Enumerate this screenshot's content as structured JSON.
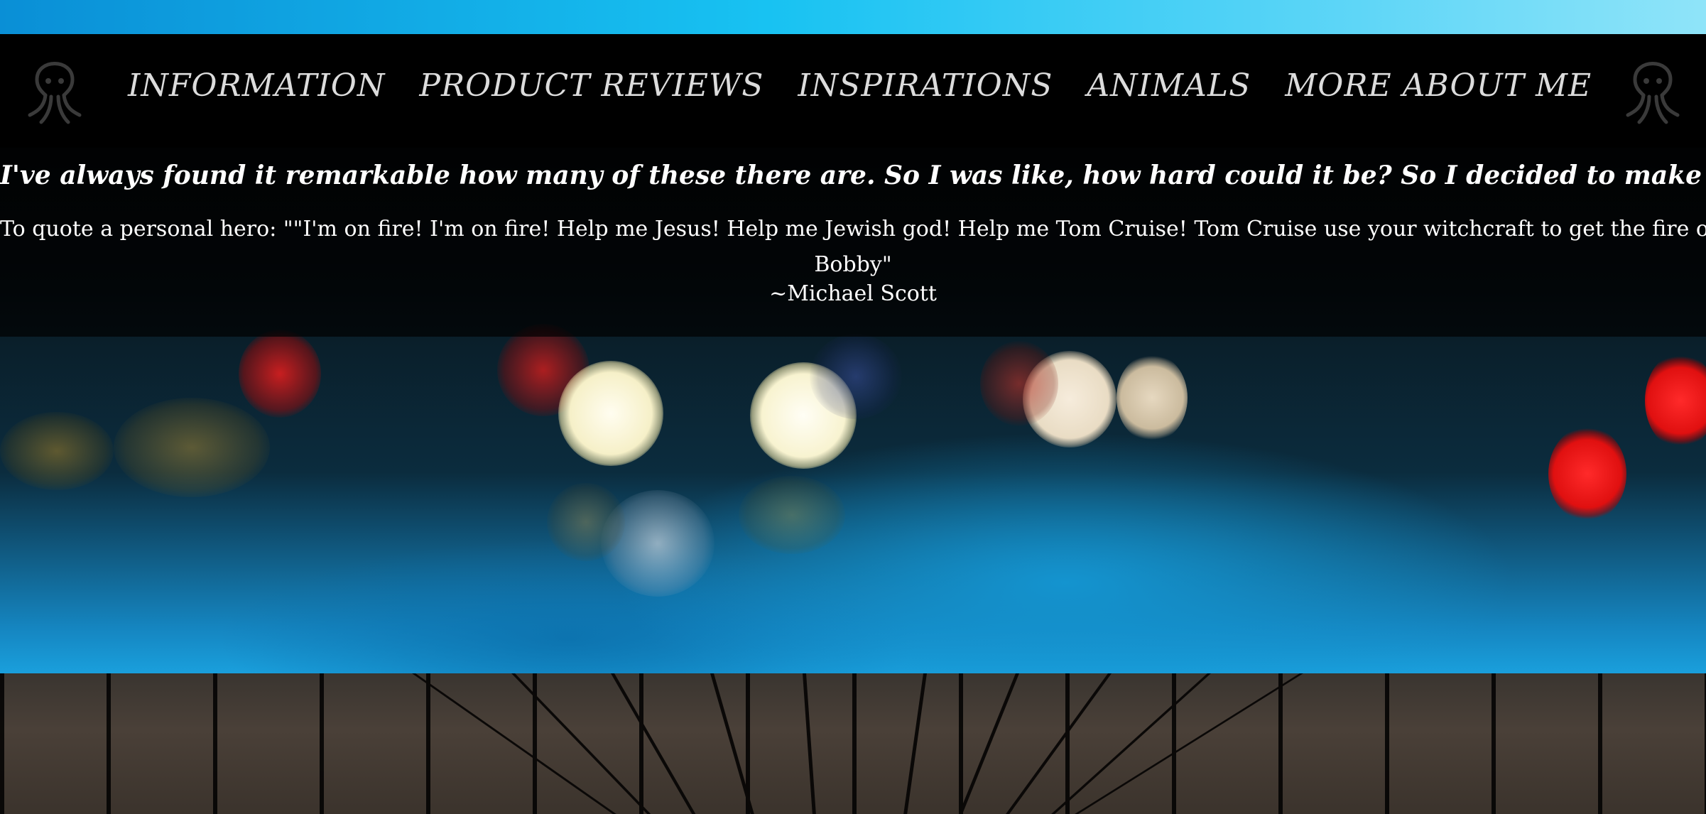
{
  "nav": {
    "items": [
      {
        "label": "INFORMATION"
      },
      {
        "label": "PRODUCT REVIEWS"
      },
      {
        "label": "INSPIRATIONS"
      },
      {
        "label": "ANIMALS"
      },
      {
        "label": "MORE ABOUT ME"
      }
    ],
    "logo_icon": "octopus-icon"
  },
  "intro": {
    "headline": "I've always found it remarkable how many of these there are. So I was like, how hard could it be? So I decided to make one on the airplane.",
    "quote_line1": "To quote a personal hero: \"\"I'm on fire! I'm on fire! Help me Jesus! Help me Jewish god! Help me Tom Cruise! Tom Cruise use your witchcraft to get the fire off of me!\" ~Ricky",
    "quote_line2": "Bobby\"",
    "attribution": "~Michael Scott"
  },
  "colors": {
    "nav_background": "#000000",
    "nav_text": "#dcdcdc",
    "intro_text": "#ffffff",
    "top_strip": "#18c2f2"
  }
}
